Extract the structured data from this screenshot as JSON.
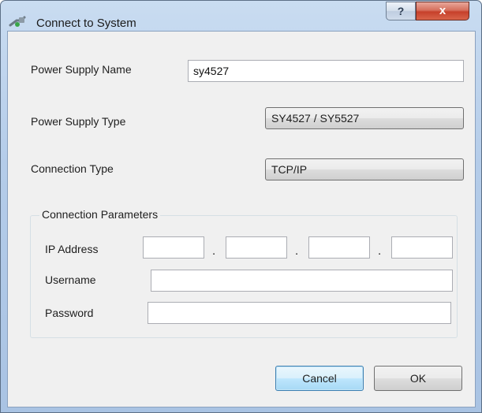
{
  "window": {
    "title": "Connect to System",
    "help_label": "?",
    "close_label": "x"
  },
  "form": {
    "power_supply_name_label": "Power Supply Name",
    "power_supply_name_value": "sy4527",
    "power_supply_type_label": "Power Supply Type",
    "power_supply_type_value": "SY4527 / SY5527",
    "connection_type_label": "Connection Type",
    "connection_type_value": "TCP/IP"
  },
  "connection_parameters": {
    "title": "Connection Parameters",
    "ip_address_label": "IP Address",
    "ip_octets": [
      "",
      "",
      "",
      ""
    ],
    "ip_separator": ".",
    "username_label": "Username",
    "username_value": "",
    "password_label": "Password",
    "password_value": ""
  },
  "buttons": {
    "cancel_label": "Cancel",
    "ok_label": "OK"
  },
  "colors": {
    "title_bar": "#b4cce9",
    "client_background": "#f0f0f0",
    "close_button": "#c6402b",
    "default_button_border": "#3c7fb1"
  },
  "icons": {
    "app": "network-plug-icon",
    "help": "help-icon",
    "close": "close-icon"
  }
}
